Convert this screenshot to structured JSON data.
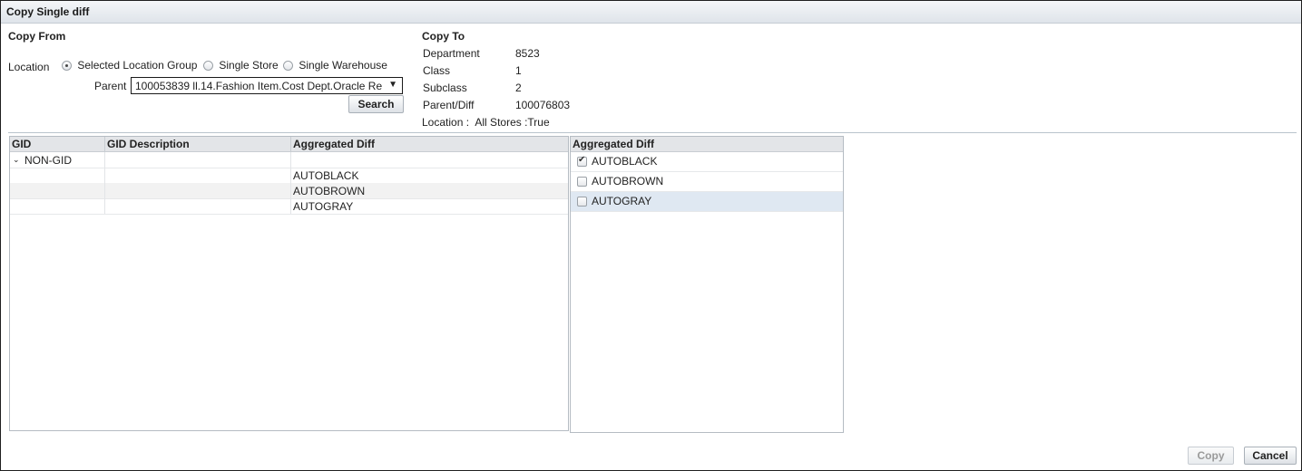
{
  "dialog": {
    "title": "Copy Single diff"
  },
  "copy_from": {
    "title": "Copy From",
    "location_label": "Location",
    "radio_options": [
      {
        "label": "Selected Location Group",
        "checked": true
      },
      {
        "label": "Single Store",
        "checked": false
      },
      {
        "label": "Single Warehouse",
        "checked": false
      }
    ],
    "parent_label": "Parent",
    "parent_value": "100053839 ll.14.Fashion Item.Cost Dept.Oracle Re",
    "search_label": "Search"
  },
  "copy_to": {
    "title": "Copy To",
    "fields": [
      {
        "label": "Department",
        "value": "8523"
      },
      {
        "label": "Class",
        "value": "1"
      },
      {
        "label": "Subclass",
        "value": "2"
      },
      {
        "label": "Parent/Diff",
        "value": "100076803"
      }
    ],
    "location_label": "Location :",
    "location_value": "All Stores :True"
  },
  "left_table": {
    "columns": [
      "GID",
      "GID Description",
      "Aggregated Diff"
    ],
    "rows": [
      {
        "gid": "NON-GID",
        "description": "",
        "diff": ""
      },
      {
        "gid": "",
        "description": "",
        "diff": "AUTOBLACK"
      },
      {
        "gid": "",
        "description": "",
        "diff": "AUTOBROWN"
      },
      {
        "gid": "",
        "description": "",
        "diff": "AUTOGRAY"
      }
    ]
  },
  "right_table": {
    "header": "Aggregated Diff",
    "items": [
      {
        "label": "AUTOBLACK",
        "checked": true
      },
      {
        "label": "AUTOBROWN",
        "checked": false
      },
      {
        "label": "AUTOGRAY",
        "checked": false
      }
    ]
  },
  "footer": {
    "copy_label": "Copy",
    "cancel_label": "Cancel"
  }
}
